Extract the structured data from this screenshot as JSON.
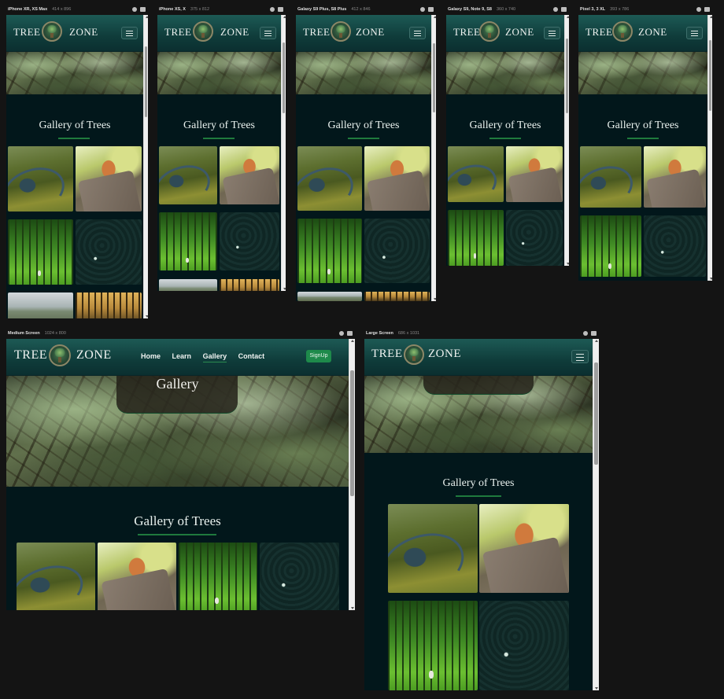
{
  "site": {
    "brand_left": "TREE",
    "brand_right": "ZONE",
    "gallery_heading": "Gallery of Trees",
    "hero_title": "Gallery",
    "nav_links": [
      "Home",
      "Learn",
      "Gallery",
      "Contact"
    ],
    "active_link": "Gallery",
    "signup_label": "SignUp"
  },
  "devices": [
    {
      "name": "iPhone XR, XS Max",
      "dims": "414 x 896"
    },
    {
      "name": "iPhone XS, X",
      "dims": "375 x 812"
    },
    {
      "name": "Galaxy S9 Plus, S8 Plus",
      "dims": "412 x 846"
    },
    {
      "name": "Galaxy S9, Note 9, S8",
      "dims": "360 x 740"
    },
    {
      "name": "Pixel 3, 3 XL",
      "dims": "393 x 786"
    },
    {
      "name": "Medium Screen",
      "dims": "1024 x 800"
    },
    {
      "name": "Large Screen",
      "dims": "686 x 1031"
    }
  ],
  "icons": {
    "settings": "gear-icon",
    "capture": "camera-icon",
    "menu": "hamburger-icon",
    "logo": "tree-logo-icon"
  },
  "colors": {
    "page_bg": "#141414",
    "site_bg": "#02171b",
    "nav_top": "#1d5a55",
    "nav_bottom": "#0b2f30",
    "accent": "#1f7a3d",
    "signup": "#1e8a4b"
  },
  "gallery_images": [
    "river-valley",
    "squirrel-on-trunk",
    "green-forest",
    "dark-pine-forest",
    "misty-landscape",
    "golden-trees"
  ]
}
